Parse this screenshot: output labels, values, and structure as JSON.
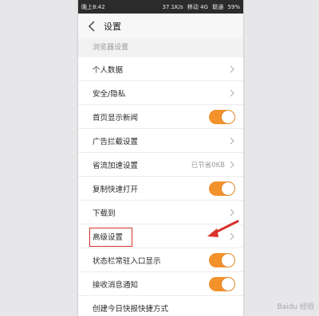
{
  "status_bar": {
    "time": "晚上8:42",
    "speed": "37.1K/s",
    "carrier1": "移动 4G",
    "carrier2": "联通",
    "battery": "59%"
  },
  "header": {
    "title": "设置"
  },
  "section": {
    "title": "浏览器设置"
  },
  "rows": [
    {
      "label": "个人数据"
    },
    {
      "label": "安全/隐私"
    },
    {
      "label": "首页显示新闻"
    },
    {
      "label": "广告拦截设置"
    },
    {
      "label": "省流加速设置",
      "value": "已节省0KB"
    },
    {
      "label": "复制快速打开"
    },
    {
      "label": "下载到"
    },
    {
      "label": "高级设置"
    },
    {
      "label": "状态栏常驻入口显示"
    },
    {
      "label": "接收消息通知"
    },
    {
      "label": "创建今日快报快捷方式"
    }
  ],
  "toggles": {
    "home_news": true,
    "copy_open": true,
    "statusbar_entry": true,
    "receive_notify": true
  },
  "colors": {
    "toggle_on": "#f3912b",
    "toggle_off": "#c9c9c9",
    "highlight": "#d9322b"
  },
  "watermark": {
    "text": "Baidu 经验"
  }
}
